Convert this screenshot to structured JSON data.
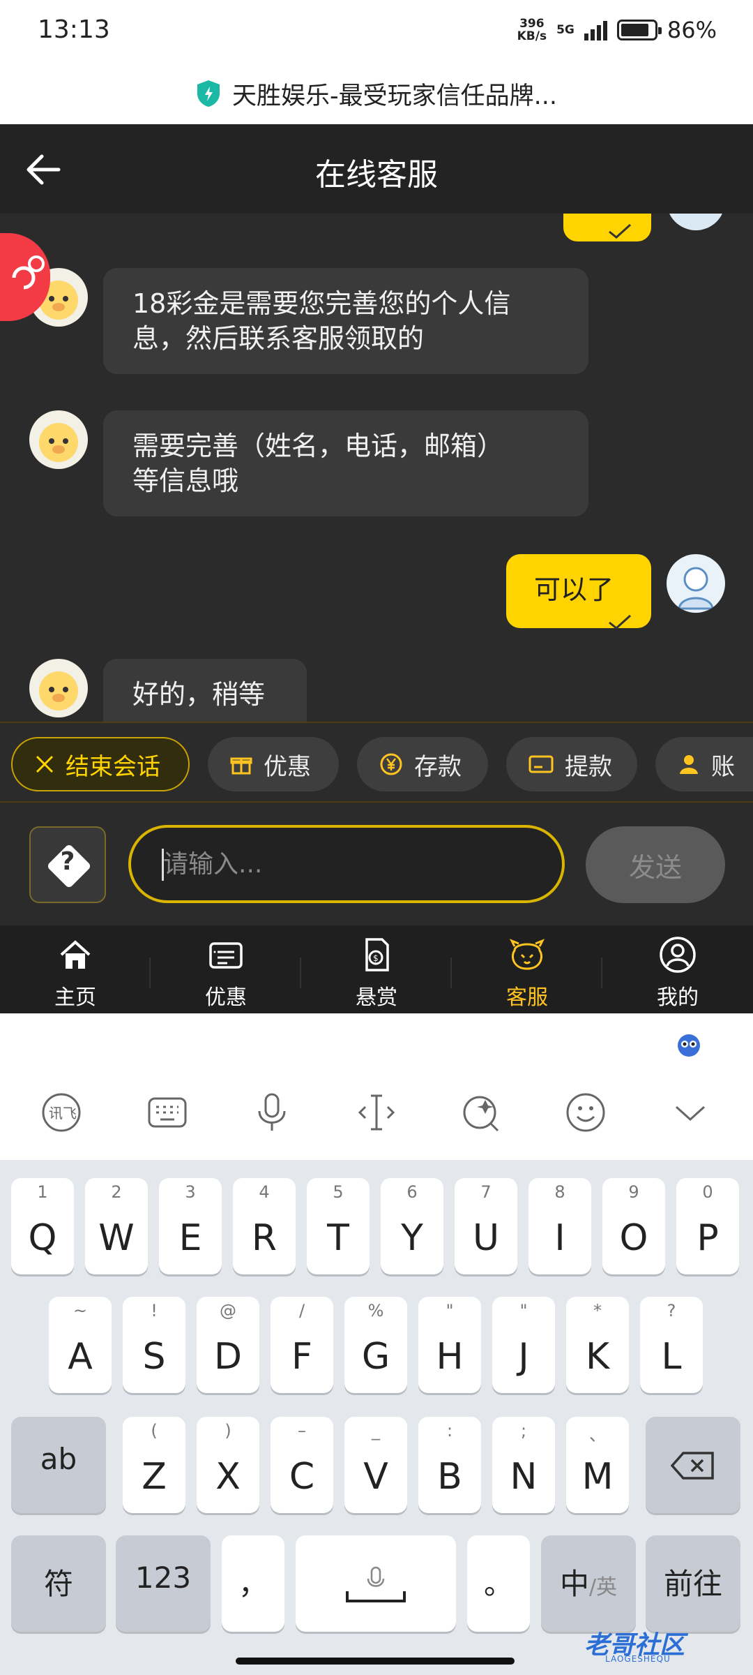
{
  "status_bar": {
    "time": "13:13",
    "net_speed_value": "396",
    "net_speed_unit": "KB/s",
    "signal": "5G",
    "battery": "86%",
    "battery_level": 0.86
  },
  "browser": {
    "page_title": "天胜娱乐-最受玩家信任品牌..."
  },
  "header": {
    "title": "在线客服"
  },
  "messages": [
    {
      "from": "agent",
      "text_line1": "18彩金是需要您完善您的个人信",
      "text_line2": "息，然后联系客服领取的"
    },
    {
      "from": "agent",
      "text_line1": "需要完善（姓名，电话，邮箱）",
      "text_line2": "等信息哦"
    },
    {
      "from": "user",
      "text": "可以了"
    },
    {
      "from": "agent",
      "text": "好的，稍等"
    }
  ],
  "quick_actions": [
    {
      "label": "结束会话",
      "icon": "close-icon"
    },
    {
      "label": "优惠",
      "icon": "gift-icon"
    },
    {
      "label": "存款",
      "icon": "yen-coin-icon"
    },
    {
      "label": "提款",
      "icon": "card-icon"
    },
    {
      "label": "账",
      "icon": "user-icon"
    }
  ],
  "composer": {
    "placeholder": "请输入...",
    "send_label": "发送"
  },
  "bottom_nav": [
    {
      "label": "主页",
      "icon": "home-icon",
      "active": false
    },
    {
      "label": "优惠",
      "icon": "ticket-icon",
      "active": false
    },
    {
      "label": "悬赏",
      "icon": "reward-doc-icon",
      "active": false
    },
    {
      "label": "客服",
      "icon": "service-mascot-icon",
      "active": true
    },
    {
      "label": "我的",
      "icon": "profile-icon",
      "active": false
    }
  ],
  "colors": {
    "accent": "#ffd400",
    "active_nav": "#ffc420",
    "chat_bg": "#2b2b2b",
    "header_bg": "#232323",
    "float_button": "#f23b45"
  },
  "keyboard": {
    "row1": [
      {
        "key": "Q",
        "hint": "1"
      },
      {
        "key": "W",
        "hint": "2"
      },
      {
        "key": "E",
        "hint": "3"
      },
      {
        "key": "R",
        "hint": "4"
      },
      {
        "key": "T",
        "hint": "5"
      },
      {
        "key": "Y",
        "hint": "6"
      },
      {
        "key": "U",
        "hint": "7"
      },
      {
        "key": "I",
        "hint": "8"
      },
      {
        "key": "O",
        "hint": "9"
      },
      {
        "key": "P",
        "hint": "0"
      }
    ],
    "row2": [
      {
        "key": "A",
        "hint": "~"
      },
      {
        "key": "S",
        "hint": "!"
      },
      {
        "key": "D",
        "hint": "@"
      },
      {
        "key": "F",
        "hint": "/"
      },
      {
        "key": "G",
        "hint": "%"
      },
      {
        "key": "H",
        "hint": "\""
      },
      {
        "key": "J",
        "hint": "\""
      },
      {
        "key": "K",
        "hint": "*"
      },
      {
        "key": "L",
        "hint": "?"
      }
    ],
    "row3": [
      {
        "key": "Z",
        "hint": "("
      },
      {
        "key": "X",
        "hint": ")"
      },
      {
        "key": "C",
        "hint": "–"
      },
      {
        "key": "V",
        "hint": "_"
      },
      {
        "key": "B",
        "hint": ":"
      },
      {
        "key": "N",
        "hint": ";"
      },
      {
        "key": "M",
        "hint": "、"
      }
    ],
    "shift_label": "ab",
    "symbols_label": "符",
    "numbers_label": "123",
    "comma_label": "，",
    "period_label": "。",
    "lang_main": "中",
    "lang_alt": "/英",
    "enter_label": "前往"
  },
  "watermark": {
    "text": "老哥社区",
    "sub": "LAOGESHEQU"
  }
}
